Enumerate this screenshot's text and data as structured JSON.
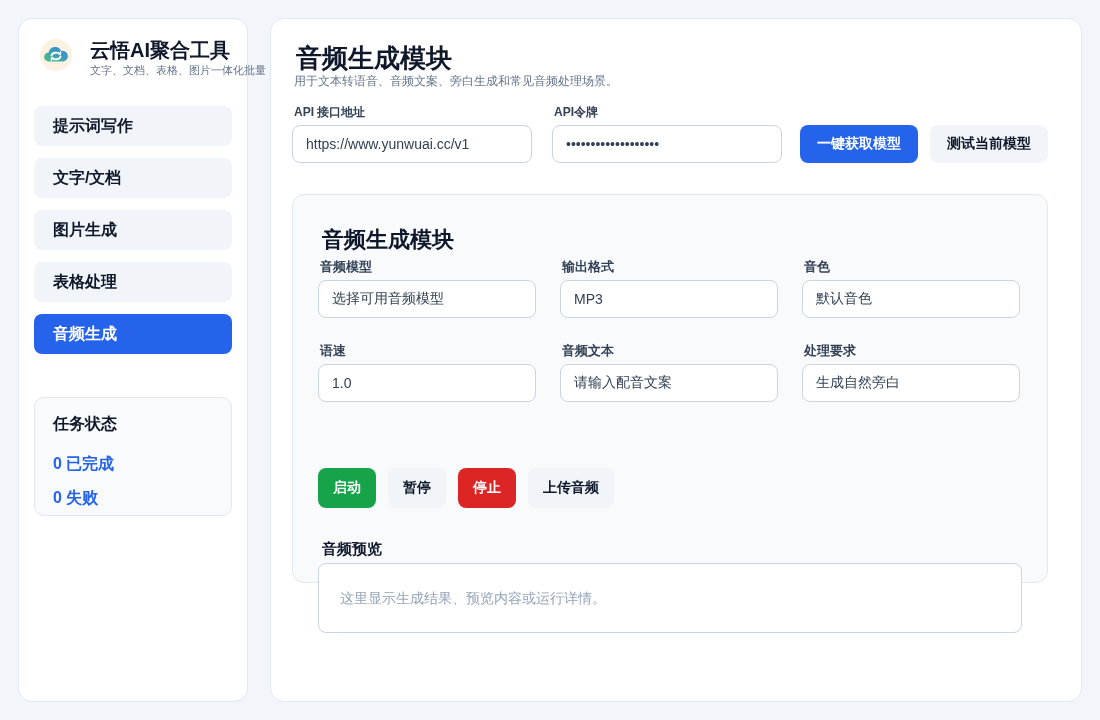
{
  "sidebar": {
    "app_title": "云悟AI聚合工具",
    "app_subtitle": "文字、文档、表格、图片一体化批量",
    "nav_items": [
      {
        "label": "提示词写作",
        "selected": false
      },
      {
        "label": "文字/文档",
        "selected": false
      },
      {
        "label": "图片生成",
        "selected": false
      },
      {
        "label": "表格处理",
        "selected": false
      },
      {
        "label": "音频生成",
        "selected": true
      }
    ],
    "task_status": {
      "title": "任务状态",
      "lines": [
        "0 已完成",
        "0 失败"
      ]
    }
  },
  "main": {
    "title": "音频生成模块",
    "subtitle": "用于文本转语音、音频文案、旁白生成和常见音频处理场景。",
    "api_fields": [
      {
        "label": "API 接口地址",
        "value": "https://www.yunwuai.cc/v1"
      },
      {
        "label": "API令牌",
        "value": "•••••••••••••••••••"
      }
    ],
    "header_buttons": [
      {
        "label": "一键获取模型",
        "kind": "primary"
      },
      {
        "label": "测试当前模型",
        "kind": "secondary"
      }
    ],
    "module": {
      "title": "音频生成模块",
      "fields": [
        {
          "label": "音频模型",
          "value": "选择可用音频模型"
        },
        {
          "label": "输出格式",
          "value": "MP3"
        },
        {
          "label": "音色",
          "value": "默认音色"
        },
        {
          "label": "语速",
          "value": "1.0"
        },
        {
          "label": "音频文本",
          "value": "请输入配音文案"
        },
        {
          "label": "处理要求",
          "value": "生成自然旁白"
        }
      ],
      "buttons": [
        {
          "label": "启动",
          "kind": "success"
        },
        {
          "label": "暂停",
          "kind": "secondary"
        },
        {
          "label": "停止",
          "kind": "danger"
        },
        {
          "label": "上传音频",
          "kind": "secondary"
        }
      ],
      "preview": {
        "label": "音频预览",
        "placeholder": "这里显示生成结果、预览内容或运行详情。"
      }
    }
  }
}
